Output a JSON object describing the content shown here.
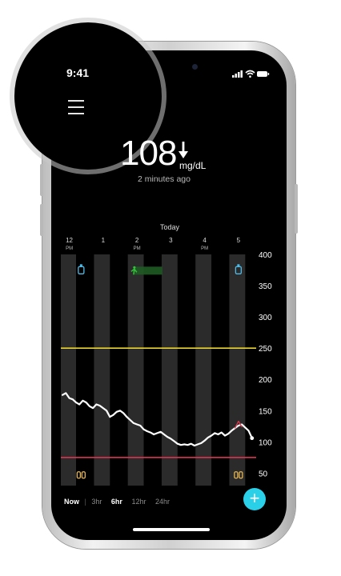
{
  "status_bar": {
    "time": "9:41",
    "icons": [
      "signal-icon",
      "wifi-icon",
      "battery-icon"
    ]
  },
  "menu": {
    "icon": "hamburger-menu-icon"
  },
  "reading": {
    "value": "108",
    "trend": "down-arrow-icon",
    "unit": "mg/dL",
    "updated": "2 minutes ago"
  },
  "chart_data": {
    "type": "line",
    "title": "Today",
    "x_ticks": [
      {
        "hour": "12",
        "ampm": "PM"
      },
      {
        "hour": "1",
        "ampm": ""
      },
      {
        "hour": "2",
        "ampm": "PM"
      },
      {
        "hour": "3",
        "ampm": ""
      },
      {
        "hour": "4",
        "ampm": "PM"
      },
      {
        "hour": "5",
        "ampm": ""
      }
    ],
    "ylim": [
      30,
      400
    ],
    "y_ticks": [
      400,
      350,
      300,
      250,
      200,
      150,
      100,
      50
    ],
    "high_threshold": 250,
    "low_threshold": 75,
    "series": [
      {
        "color": "#ffffff",
        "hours": [
          11.8,
          11.9,
          12.0,
          12.1,
          12.2,
          12.3,
          12.4,
          12.5,
          12.6,
          12.7,
          12.8,
          12.9,
          13.0,
          13.1,
          13.2,
          13.3,
          13.4,
          13.5,
          13.6,
          13.7,
          13.8,
          13.9,
          14.0,
          14.1,
          14.2,
          14.3,
          14.4,
          14.5,
          14.6,
          14.7,
          14.8,
          14.9,
          15.0,
          15.1,
          15.2,
          15.3,
          15.4,
          15.5,
          15.6,
          15.7,
          15.8,
          15.9,
          16.0,
          16.1,
          16.2,
          16.3,
          16.4,
          16.5,
          16.6,
          16.7,
          16.8,
          16.9,
          17.0,
          17.1,
          17.3,
          17.4
        ],
        "values": [
          175,
          178,
          170,
          168,
          163,
          160,
          166,
          163,
          157,
          154,
          160,
          158,
          154,
          150,
          140,
          143,
          148,
          150,
          146,
          140,
          135,
          130,
          128,
          126,
          120,
          117,
          115,
          112,
          114,
          116,
          112,
          108,
          105,
          101,
          97,
          95,
          96,
          95,
          97,
          94,
          96,
          98,
          102,
          107,
          110,
          114,
          112,
          115,
          110,
          113,
          118,
          122,
          126,
          128,
          118,
          106
        ]
      },
      {
        "color": "#e0384e",
        "hours": [
          16.9,
          17.0,
          17.1
        ],
        "values": [
          122,
          133,
          124
        ]
      }
    ],
    "event_icons": [
      {
        "icon": "insulin-pen-icon",
        "hour": 12.35,
        "value": 374,
        "color": "#4fb9e6"
      },
      {
        "icon": "running-exercise-icon",
        "hour": 13.9,
        "value": 374,
        "color": "#32c13a",
        "end_hour": 14.75
      },
      {
        "icon": "insulin-pen-icon",
        "hour": 17.0,
        "value": 374,
        "color": "#4fb9e6"
      },
      {
        "icon": "meal-icon",
        "hour": 12.35,
        "value": 47,
        "color": "#e5b450"
      },
      {
        "icon": "meal-icon",
        "hour": 17.0,
        "value": 47,
        "color": "#e5b450"
      }
    ],
    "grid": false
  },
  "range_tabs": [
    {
      "label": "Now",
      "selected": true
    },
    {
      "label": "3hr",
      "selected": false
    },
    {
      "label": "6hr",
      "selected": true
    },
    {
      "label": "12hr",
      "selected": false
    },
    {
      "label": "24hr",
      "selected": false
    }
  ],
  "fab": {
    "label": "+",
    "icon": "plus-icon",
    "color": "#2ad0e8"
  }
}
